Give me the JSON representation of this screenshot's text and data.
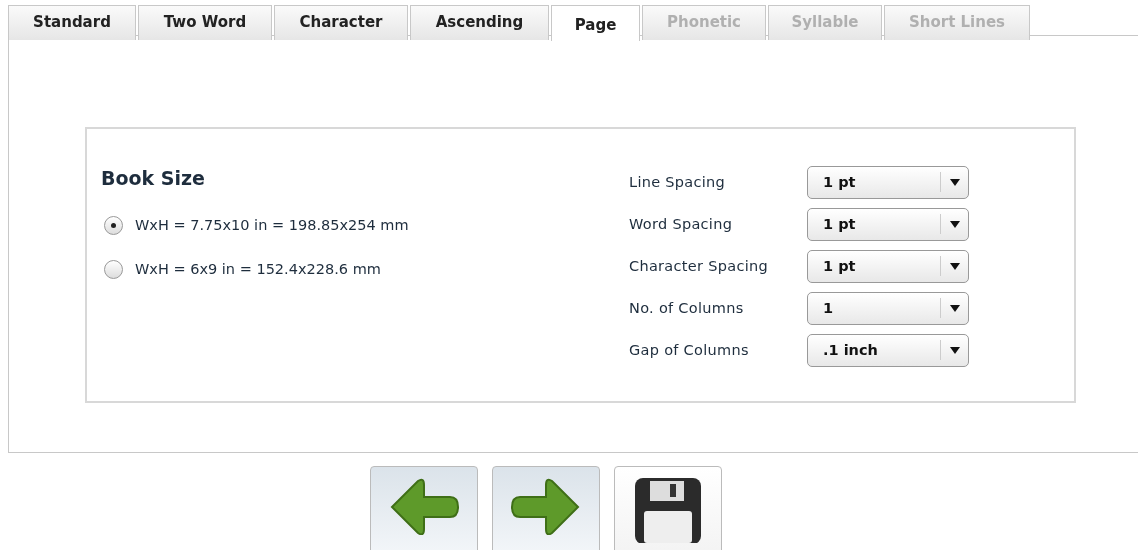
{
  "tabs": [
    {
      "label": "Standard",
      "selected": false,
      "disabled": false
    },
    {
      "label": "Two Word",
      "selected": false,
      "disabled": false
    },
    {
      "label": "Character",
      "selected": false,
      "disabled": false
    },
    {
      "label": "Ascending",
      "selected": false,
      "disabled": false
    },
    {
      "label": "Page",
      "selected": true,
      "disabled": false
    },
    {
      "label": "Phonetic",
      "selected": false,
      "disabled": true
    },
    {
      "label": "Syllable",
      "selected": false,
      "disabled": true
    },
    {
      "label": "Short Lines",
      "selected": false,
      "disabled": true
    }
  ],
  "book_size": {
    "title": "Book Size",
    "options": [
      {
        "label": "WxH = 7.75x10 in = 198.85x254 mm",
        "selected": true
      },
      {
        "label": "WxH = 6x9 in = 152.4x228.6 mm",
        "selected": false
      }
    ]
  },
  "settings": [
    {
      "label": "Line Spacing",
      "value": "1 pt"
    },
    {
      "label": "Word Spacing",
      "value": "1 pt"
    },
    {
      "label": "Character Spacing",
      "value": "1 pt"
    },
    {
      "label": "No. of Columns",
      "value": "1"
    },
    {
      "label": "Gap of Columns",
      "value": ".1 inch"
    }
  ],
  "buttons": [
    {
      "kind": "back"
    },
    {
      "kind": "forward"
    },
    {
      "kind": "save"
    }
  ]
}
